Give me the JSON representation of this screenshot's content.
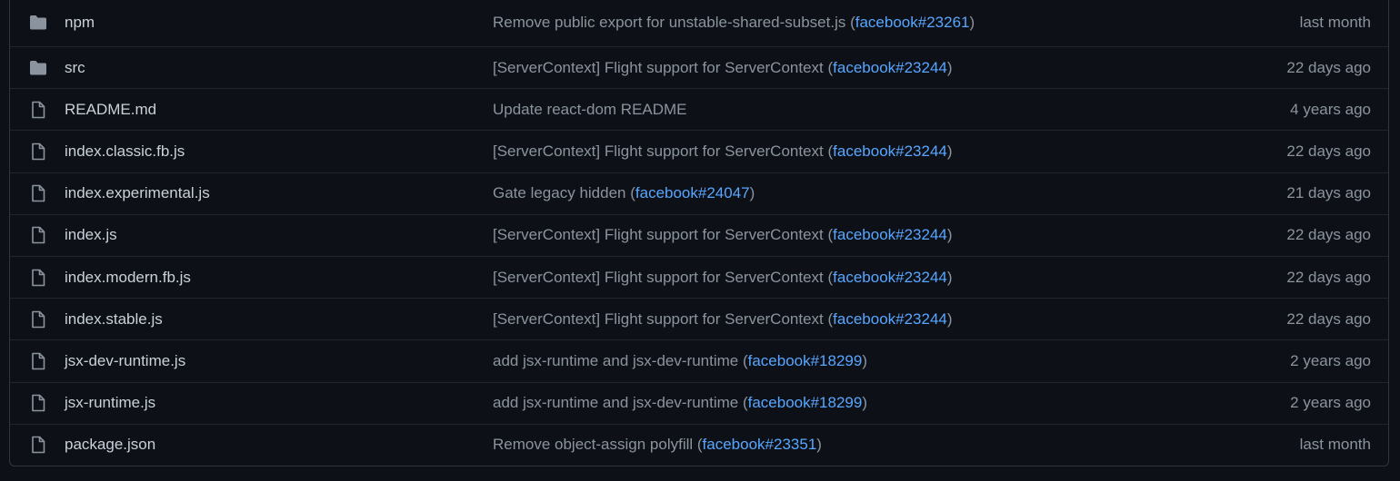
{
  "colors": {
    "background": "#0d1117",
    "border": "#30363d",
    "text": "#c9d1d9",
    "muted": "#8b949e",
    "link": "#58a6ff",
    "folder_icon": "#8b949e"
  },
  "files": [
    {
      "icon": "folder-icon",
      "name": "npm",
      "commit_before": "Remove public export for unstable-shared-subset.js (",
      "commit_link": "facebook#23261",
      "commit_after": ")",
      "age": "last month"
    },
    {
      "icon": "folder-icon",
      "name": "src",
      "commit_before": "[ServerContext] Flight support for ServerContext (",
      "commit_link": "facebook#23244",
      "commit_after": ")",
      "age": "22 days ago"
    },
    {
      "icon": "file-icon",
      "name": "README.md",
      "commit_before": "Update react-dom README",
      "commit_link": "",
      "commit_after": "",
      "age": "4 years ago"
    },
    {
      "icon": "file-icon",
      "name": "index.classic.fb.js",
      "commit_before": "[ServerContext] Flight support for ServerContext (",
      "commit_link": "facebook#23244",
      "commit_after": ")",
      "age": "22 days ago"
    },
    {
      "icon": "file-icon",
      "name": "index.experimental.js",
      "commit_before": "Gate legacy hidden (",
      "commit_link": "facebook#24047",
      "commit_after": ")",
      "age": "21 days ago"
    },
    {
      "icon": "file-icon",
      "name": "index.js",
      "commit_before": "[ServerContext] Flight support for ServerContext (",
      "commit_link": "facebook#23244",
      "commit_after": ")",
      "age": "22 days ago"
    },
    {
      "icon": "file-icon",
      "name": "index.modern.fb.js",
      "commit_before": "[ServerContext] Flight support for ServerContext (",
      "commit_link": "facebook#23244",
      "commit_after": ")",
      "age": "22 days ago"
    },
    {
      "icon": "file-icon",
      "name": "index.stable.js",
      "commit_before": "[ServerContext] Flight support for ServerContext (",
      "commit_link": "facebook#23244",
      "commit_after": ")",
      "age": "22 days ago"
    },
    {
      "icon": "file-icon",
      "name": "jsx-dev-runtime.js",
      "commit_before": "add jsx-runtime and jsx-dev-runtime (",
      "commit_link": "facebook#18299",
      "commit_after": ")",
      "age": "2 years ago"
    },
    {
      "icon": "file-icon",
      "name": "jsx-runtime.js",
      "commit_before": "add jsx-runtime and jsx-dev-runtime (",
      "commit_link": "facebook#18299",
      "commit_after": ")",
      "age": "2 years ago"
    },
    {
      "icon": "file-icon",
      "name": "package.json",
      "commit_before": "Remove object-assign polyfill (",
      "commit_link": "facebook#23351",
      "commit_after": ")",
      "age": "last month"
    }
  ]
}
